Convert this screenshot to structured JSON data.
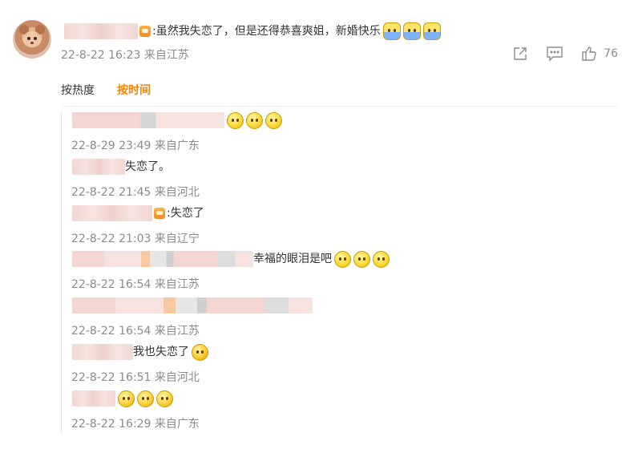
{
  "comment": {
    "text": ":虽然我失恋了，但是还得恭喜爽姐，新婚快乐",
    "time": "22-8-22 16:23",
    "location": "来自江苏",
    "like_count": "76",
    "icons": [
      "share-icon",
      "comment-icon",
      "like-icon"
    ]
  },
  "sort": {
    "hot_label": "按热度",
    "time_label": "按时间",
    "active": "按时间",
    "active_color": "#ff8200"
  },
  "replies": [
    {
      "text": "",
      "time": "22-8-29 23:49",
      "location": "来自广东"
    },
    {
      "text": "失恋了。",
      "time": "22-8-22 21:45",
      "location": "来自河北"
    },
    {
      "text": ":失恋了",
      "time": "22-8-22 21:03",
      "location": "来自辽宁"
    },
    {
      "text": "幸福的眼泪是吧",
      "time": "22-8-22 16:54",
      "location": "来自江苏"
    },
    {
      "text": "",
      "time": "22-8-22 16:54",
      "location": "来自江苏"
    },
    {
      "text": "我也失恋了",
      "time": "22-8-22 16:51",
      "location": "来自河北"
    },
    {
      "text": "",
      "time": "22-8-22 16:29",
      "location": "来自广东"
    }
  ],
  "colors": {
    "meta_gray": "#8b8b8b",
    "accent": "#ff8200"
  }
}
